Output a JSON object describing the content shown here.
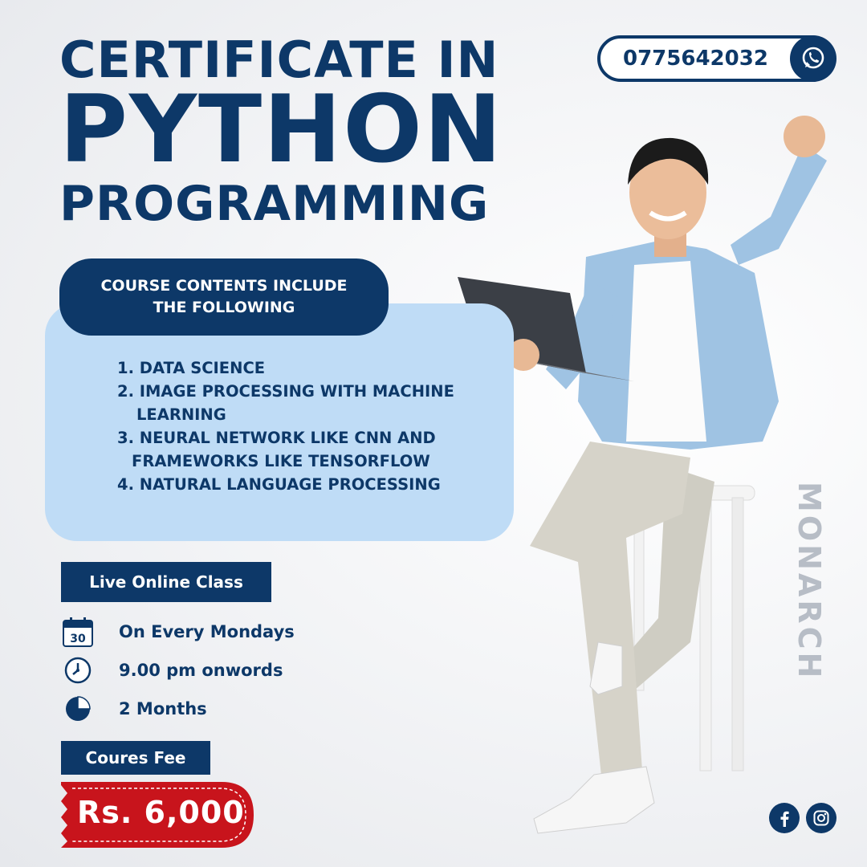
{
  "title": {
    "line1": "CERTIFICATE IN",
    "line2": "PYTHON",
    "line3": "PROGRAMMING"
  },
  "contact": {
    "phone": "0775642032",
    "icon": "whatsapp-icon"
  },
  "course": {
    "header_line1": "COURSE CONTENTS INCLUDE",
    "header_line2": "THE FOLLOWING",
    "items": [
      "1. DATA SCIENCE",
      "2. IMAGE PROCESSING WITH MACHINE",
      "LEARNING",
      "3. NEURAL NETWORK LIKE CNN AND",
      "FRAMEWORKS LIKE TENSORFLOW",
      "4. NATURAL LANGUAGE PROCESSING"
    ]
  },
  "schedule": {
    "mode_label": "Live Online Class",
    "rows": [
      {
        "icon": "calendar-icon",
        "icon_text": "30",
        "text": "On Every Mondays"
      },
      {
        "icon": "clock-icon",
        "text": "9.00 pm onwords"
      },
      {
        "icon": "pie-chart-icon",
        "text": "2 Months"
      }
    ]
  },
  "fee": {
    "label": "Coures Fee",
    "amount": "Rs. 6,000"
  },
  "brand": {
    "name": "MONARCH"
  },
  "social": [
    "facebook-icon",
    "instagram-icon"
  ],
  "colors": {
    "navy": "#0d3868",
    "light_blue": "#bfdcf6",
    "price_red": "#c8141c",
    "brand_gray": "#b7bdc6"
  }
}
